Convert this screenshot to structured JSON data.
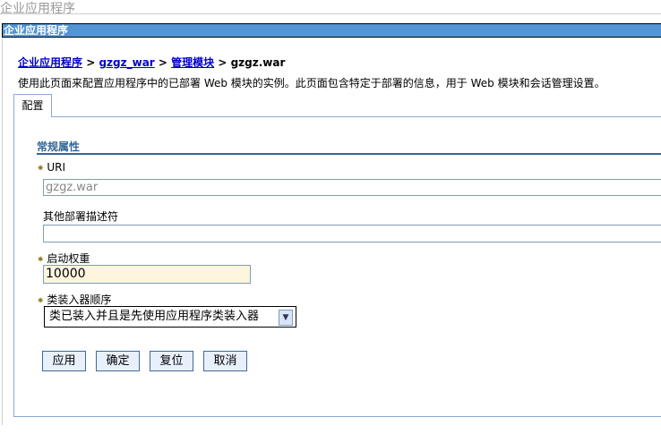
{
  "page_title": "企业应用程序",
  "header_bar": "企业应用程序",
  "breadcrumb": {
    "items": [
      "企业应用程序",
      "gzgz_war",
      "管理模块"
    ],
    "current": "gzgz.war",
    "separator": ">"
  },
  "description": "使用此页面来配置应用程序中的已部署 Web 模块的实例。此页面包含特定于部署的信息，用于 Web 模块和会话管理设置。",
  "tabs": [
    {
      "label": "配置"
    }
  ],
  "section": "常规属性",
  "fields": {
    "uri": {
      "label": "URI",
      "value": "gzgz.war"
    },
    "other_desc": {
      "label": "其他部署描述符",
      "value": ""
    },
    "startup_weight": {
      "label": "启动权重",
      "value": "10000"
    },
    "classloader_order": {
      "label": "类装入器顺序",
      "value": "类已装入并且是先使用应用程序类装入器"
    }
  },
  "buttons": {
    "apply": "应用",
    "ok": "确定",
    "reset": "复位",
    "cancel": "取消"
  }
}
